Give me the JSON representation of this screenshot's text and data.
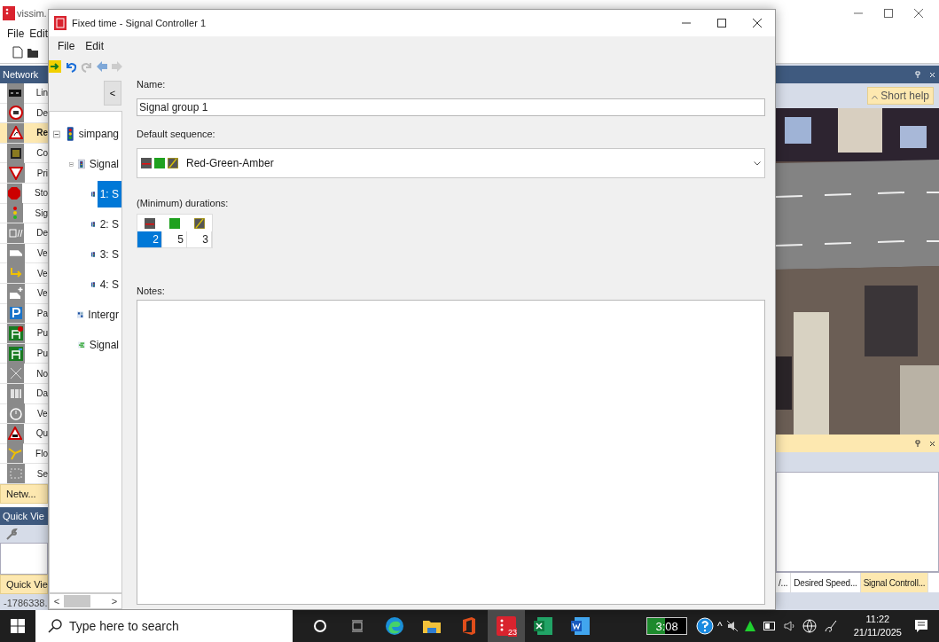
{
  "app": {
    "title": "vissim.",
    "menu": [
      "File",
      "Edit"
    ],
    "network_panel": {
      "title": "Network",
      "items": [
        {
          "label": "Lin",
          "selected": false
        },
        {
          "label": "De",
          "selected": false
        },
        {
          "label": "Re",
          "selected": true
        },
        {
          "label": "Co",
          "selected": false
        },
        {
          "label": "Pri",
          "selected": false
        },
        {
          "label": "Sto",
          "selected": false
        },
        {
          "label": "Sig",
          "selected": false
        },
        {
          "label": "De",
          "selected": false
        },
        {
          "label": "Ve",
          "selected": false
        },
        {
          "label": "Ve",
          "selected": false
        },
        {
          "label": "Ve",
          "selected": false
        },
        {
          "label": "Pa",
          "selected": false
        },
        {
          "label": "Pu",
          "selected": false
        },
        {
          "label": "Pu",
          "selected": false
        },
        {
          "label": "No",
          "selected": false
        },
        {
          "label": "Da",
          "selected": false
        },
        {
          "label": "Ve",
          "selected": false
        },
        {
          "label": "Qu",
          "selected": false
        },
        {
          "label": "Flo",
          "selected": false
        },
        {
          "label": "Se",
          "selected": false
        }
      ],
      "tab": "Netw..."
    },
    "quick_view": {
      "title": "Quick Vie",
      "tab": "Quick Vie"
    },
    "status": "-1786338.",
    "short_help": "Short help",
    "bottom_tabs": [
      {
        "label": "/...",
        "selected": false
      },
      {
        "label": "Desired Speed...",
        "selected": false
      },
      {
        "label": "Signal Controll...",
        "selected": true
      }
    ]
  },
  "dialog": {
    "title": "Fixed time - Signal Controller 1",
    "menu": [
      "File",
      "Edit"
    ],
    "collapse_button": "<",
    "tree": [
      {
        "label": "simpang",
        "expanded": true,
        "selected": false,
        "children": [
          {
            "label": "Signal",
            "expanded": true,
            "selected": false,
            "children": [
              {
                "label": "1: S",
                "selected": true
              },
              {
                "label": "2: S",
                "selected": false
              },
              {
                "label": "3: S",
                "selected": false
              },
              {
                "label": "4: S",
                "selected": false
              }
            ]
          },
          {
            "label": "Intergr",
            "selected": false
          },
          {
            "label": "Signal",
            "selected": false
          }
        ]
      }
    ],
    "scroll_left": "<",
    "scroll_right": ">",
    "name_label": "Name:",
    "name_value": "Signal group 1",
    "sequence_label": "Default sequence:",
    "sequence": {
      "value": "Red-Green-Amber",
      "steps": [
        {
          "kind": "red"
        },
        {
          "kind": "green"
        },
        {
          "kind": "amber"
        }
      ]
    },
    "durations_label": "(Minimum) durations:",
    "durations": [
      {
        "kind": "red",
        "value": "2",
        "selected": true
      },
      {
        "kind": "green",
        "value": "5",
        "selected": false
      },
      {
        "kind": "amber",
        "value": "3",
        "selected": false
      }
    ],
    "notes_label": "Notes:"
  },
  "taskbar": {
    "search_placeholder": "Type here to search",
    "apps": [
      {
        "kind": "cortana",
        "active": false
      },
      {
        "kind": "taskview",
        "active": false
      },
      {
        "kind": "edge",
        "active": false
      },
      {
        "kind": "explorer",
        "active": false
      },
      {
        "kind": "office",
        "active": false
      },
      {
        "kind": "vissim",
        "active": true,
        "badge": "23"
      },
      {
        "kind": "excel",
        "active": false
      },
      {
        "kind": "word",
        "active": false
      }
    ],
    "battery": "3:08",
    "tray_caret": "^",
    "time": "11:22",
    "date": "21/11/2025"
  }
}
